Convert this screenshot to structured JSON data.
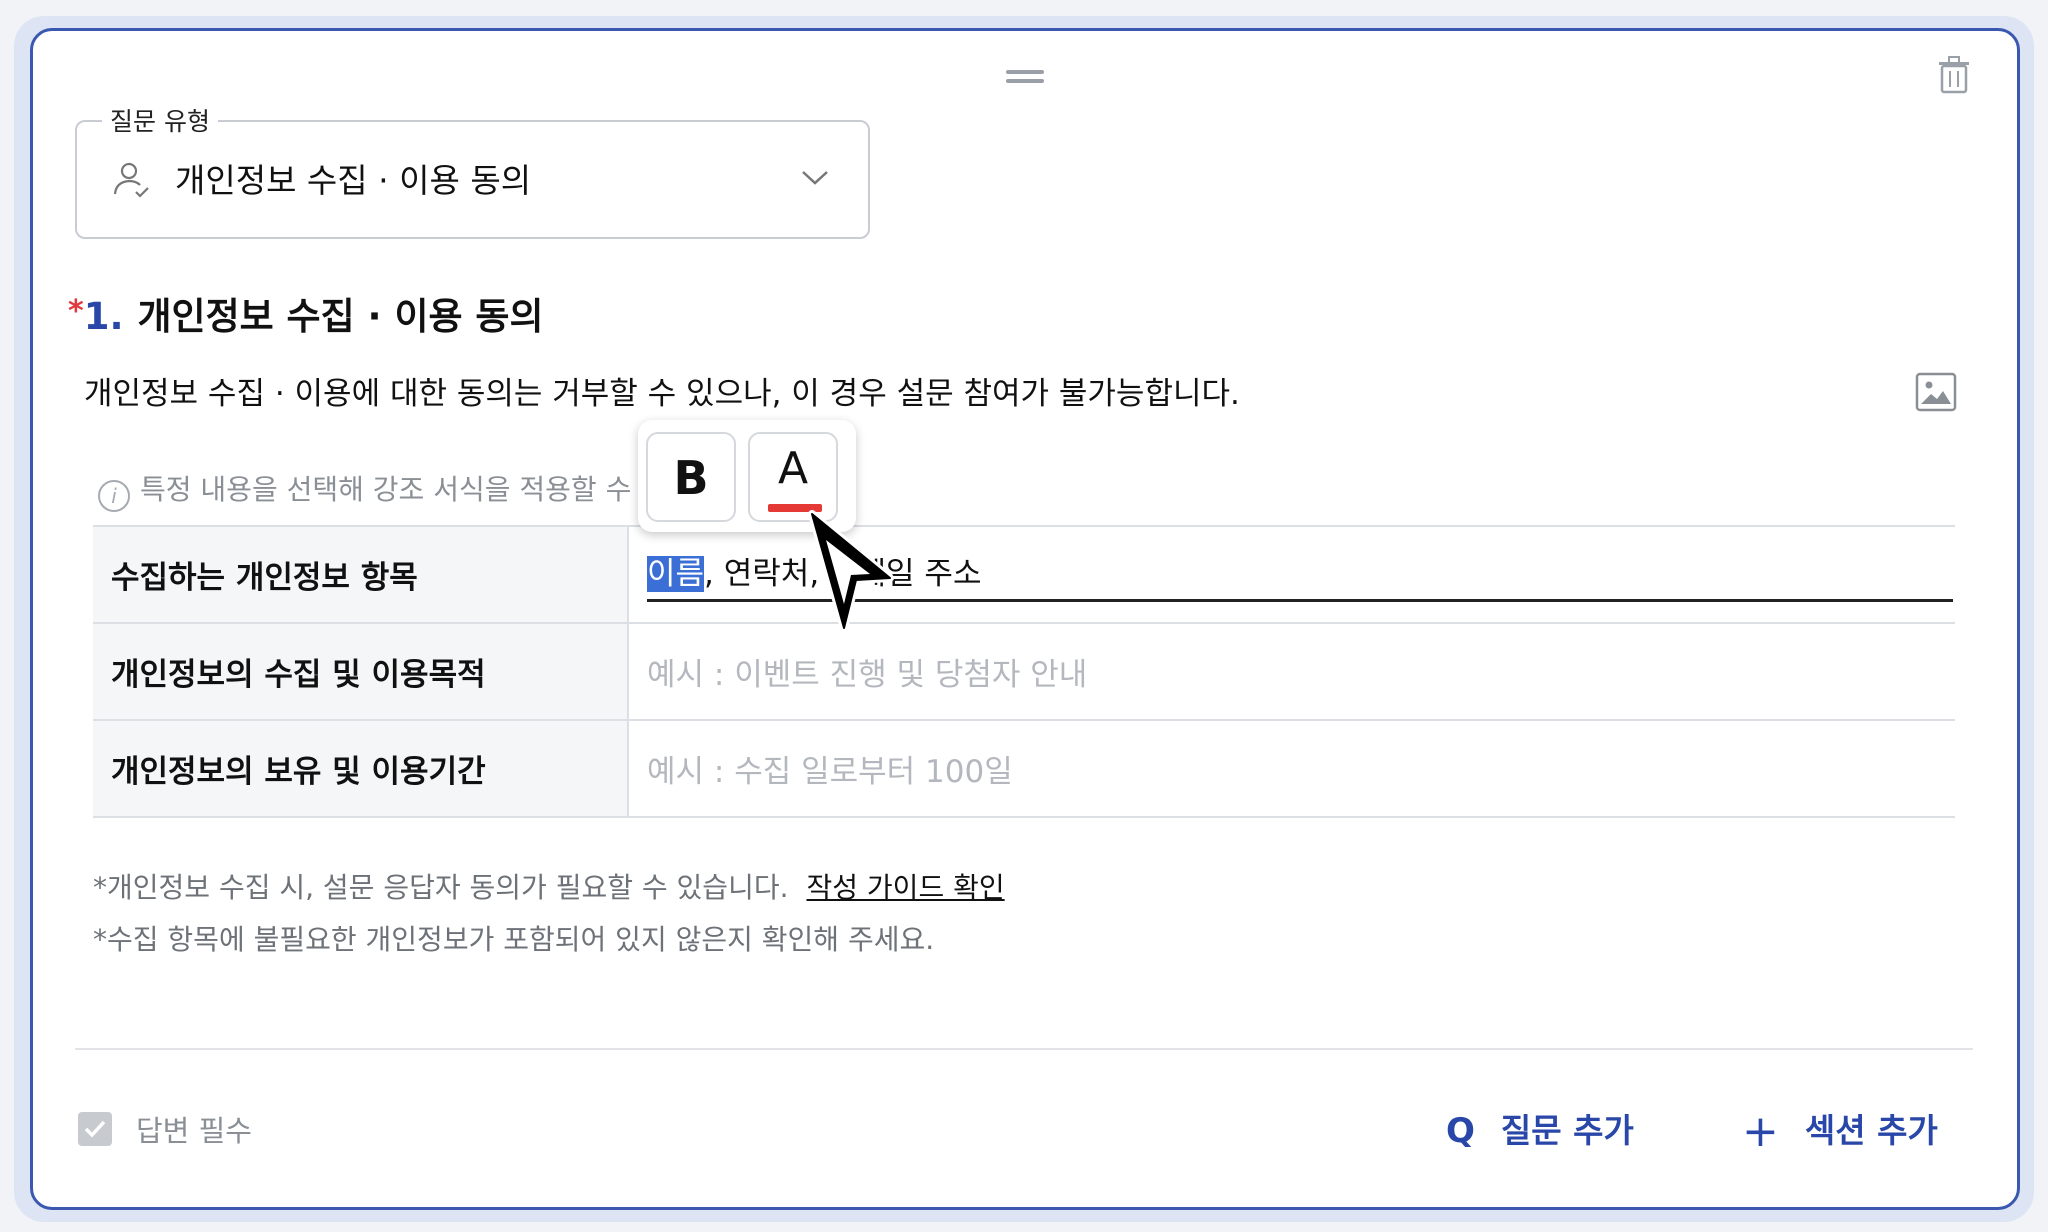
{
  "question_type": {
    "legend": "질문 유형",
    "value": "개인정보 수집 · 이용 동의",
    "icon": "person-check-icon"
  },
  "question": {
    "required_mark": "*",
    "number": "1.",
    "title": "개인정보 수집 · 이용 동의",
    "description": "개인정보 수집 · 이용에 대한 동의는 거부할 수 있으나, 이 경우 설문 참여가 불가능합니다."
  },
  "hint": "특정 내용을 선택해 강조 서식을 적용할 수",
  "table": {
    "rows": [
      {
        "label": "수집하는 개인정보 항목",
        "selected": "이름",
        "rest": ", 연락처, 이메일 주소"
      },
      {
        "label": "개인정보의 수집 및 이용목적",
        "placeholder": "예시 : 이벤트 진행 및 당첨자 안내"
      },
      {
        "label": "개인정보의 보유 및 이용기간",
        "placeholder": "예시 : 수집 일로부터 100일"
      }
    ]
  },
  "notes": {
    "note1": "*개인정보 수집 시, 설문 응답자 동의가 필요할 수 있습니다.",
    "guide_link": "작성 가이드 확인",
    "note2": "*수집 항목에 불필요한 개인정보가 포함되어 있지 않은지 확인해 주세요."
  },
  "format_toolbar": {
    "bold_label": "B",
    "color_label": "A",
    "color_accent": "#e53935"
  },
  "footer": {
    "required_label": "답변 필수",
    "add_question_icon": "Q",
    "add_question_label": "질문 추가",
    "add_section_icon": "+",
    "add_section_label": "섹션 추가"
  },
  "colors": {
    "accent": "#2947a8",
    "required": "#e0393e",
    "selection": "#3c6fd6"
  }
}
